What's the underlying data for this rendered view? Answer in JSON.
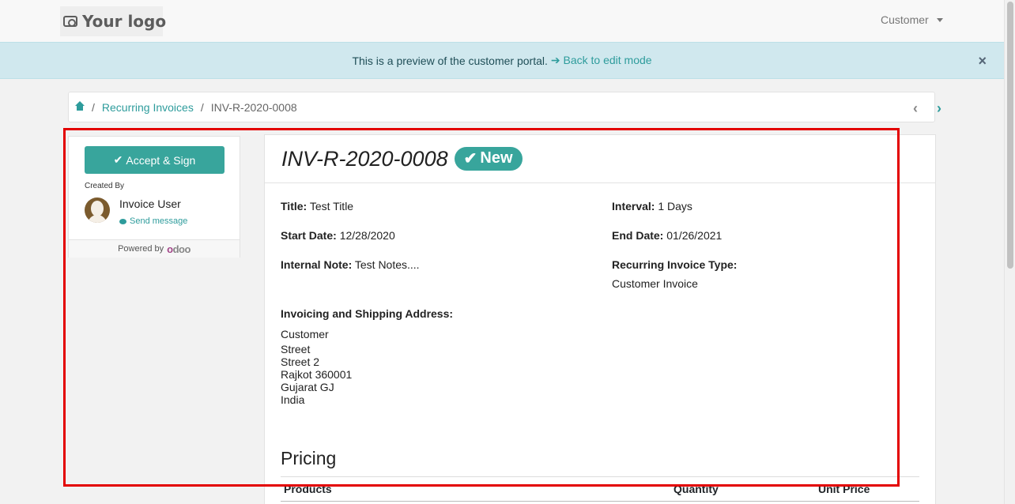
{
  "header": {
    "logo_text": "Your logo",
    "user_menu": "Customer"
  },
  "alert": {
    "text": "This is a preview of the customer portal.",
    "link": "Back to edit mode",
    "close": "×"
  },
  "breadcrumb": {
    "home_icon": "home-icon",
    "items": [
      "Recurring Invoices",
      "INV-R-2020-0008"
    ],
    "sep": "/",
    "prev": "‹",
    "next": "›"
  },
  "sidebar": {
    "accept_label": "Accept & Sign",
    "created_by_label": "Created By",
    "user_name": "Invoice User",
    "send_message": "Send message",
    "powered_by": "Powered by",
    "odoo_logo": "odoo"
  },
  "invoice": {
    "number": "INV-R-2020-0008",
    "status": "New",
    "title_label": "Title:",
    "title_value": "Test Title",
    "interval_label": "Interval:",
    "interval_value": "1 Days",
    "start_label": "Start Date:",
    "start_value": "12/28/2020",
    "end_label": "End Date:",
    "end_value": "01/26/2021",
    "note_label": "Internal Note:",
    "note_value": "Test Notes....",
    "type_label": "Recurring Invoice Type:",
    "type_value": "Customer Invoice",
    "address_label": "Invoicing and Shipping Address:",
    "address_name": "Customer",
    "address_lines": [
      "Street",
      "Street 2",
      "Rajkot 360001",
      "Gujarat GJ",
      "India"
    ],
    "pricing_label": "Pricing",
    "columns": [
      "Products",
      "Quantity",
      "Unit Price"
    ]
  },
  "accent_color": "#38a59c",
  "highlight_color": "#e30000"
}
